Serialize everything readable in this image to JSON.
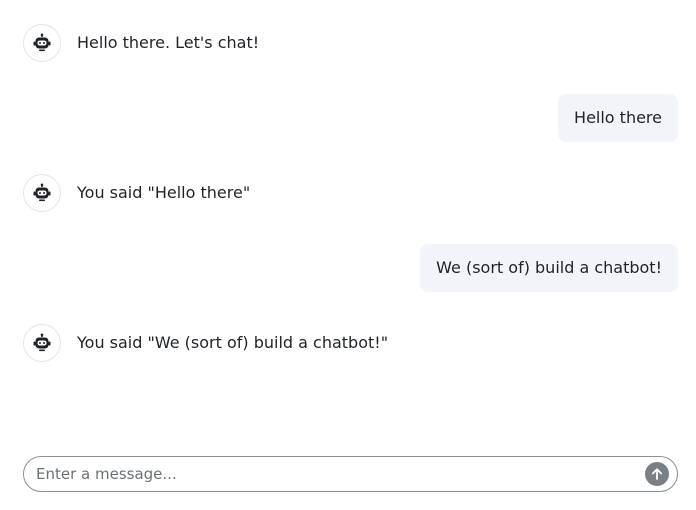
{
  "messages": [
    {
      "role": "bot",
      "text": "Hello there. Let's chat!",
      "avatar_icon": "robot-icon"
    },
    {
      "role": "user",
      "text": "Hello there"
    },
    {
      "role": "bot",
      "text": "You said \"Hello there\"",
      "avatar_icon": "robot-icon"
    },
    {
      "role": "user",
      "text": "We (sort of) build a chatbot!"
    },
    {
      "role": "bot",
      "text": "You said \"We (sort of) build a chatbot!\"",
      "avatar_icon": "robot-icon"
    }
  ],
  "composer": {
    "placeholder": "Enter a message...",
    "value": "",
    "send_icon": "arrow-up-icon"
  },
  "colors": {
    "user_bubble_bg": "#f1f5f9",
    "send_button_bg": "#7a7f86",
    "avatar_border": "#e3e5e8"
  }
}
